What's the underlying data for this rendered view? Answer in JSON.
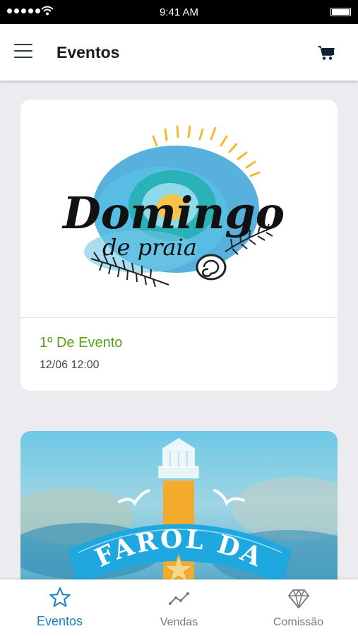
{
  "status_bar": {
    "time": "9:41 AM"
  },
  "header": {
    "title": "Eventos",
    "menu_icon": "hamburger-menu-icon",
    "cart_icon": "shopping-cart-icon"
  },
  "events": [
    {
      "logo_line1": "Domingo",
      "logo_line2": "de praia",
      "name": "1º De Evento",
      "date": "12/06 12:00"
    },
    {
      "banner_text": "FAROL DA"
    }
  ],
  "tabs": [
    {
      "label": "Eventos",
      "icon": "star-icon",
      "active": true
    },
    {
      "label": "Vendas",
      "icon": "trend-line-icon",
      "active": false
    },
    {
      "label": "Comissão",
      "icon": "diamond-icon",
      "active": false
    }
  ],
  "colors": {
    "accent": "#1a7fc6",
    "event_name": "#5a9e14",
    "background": "#ecebf0"
  }
}
